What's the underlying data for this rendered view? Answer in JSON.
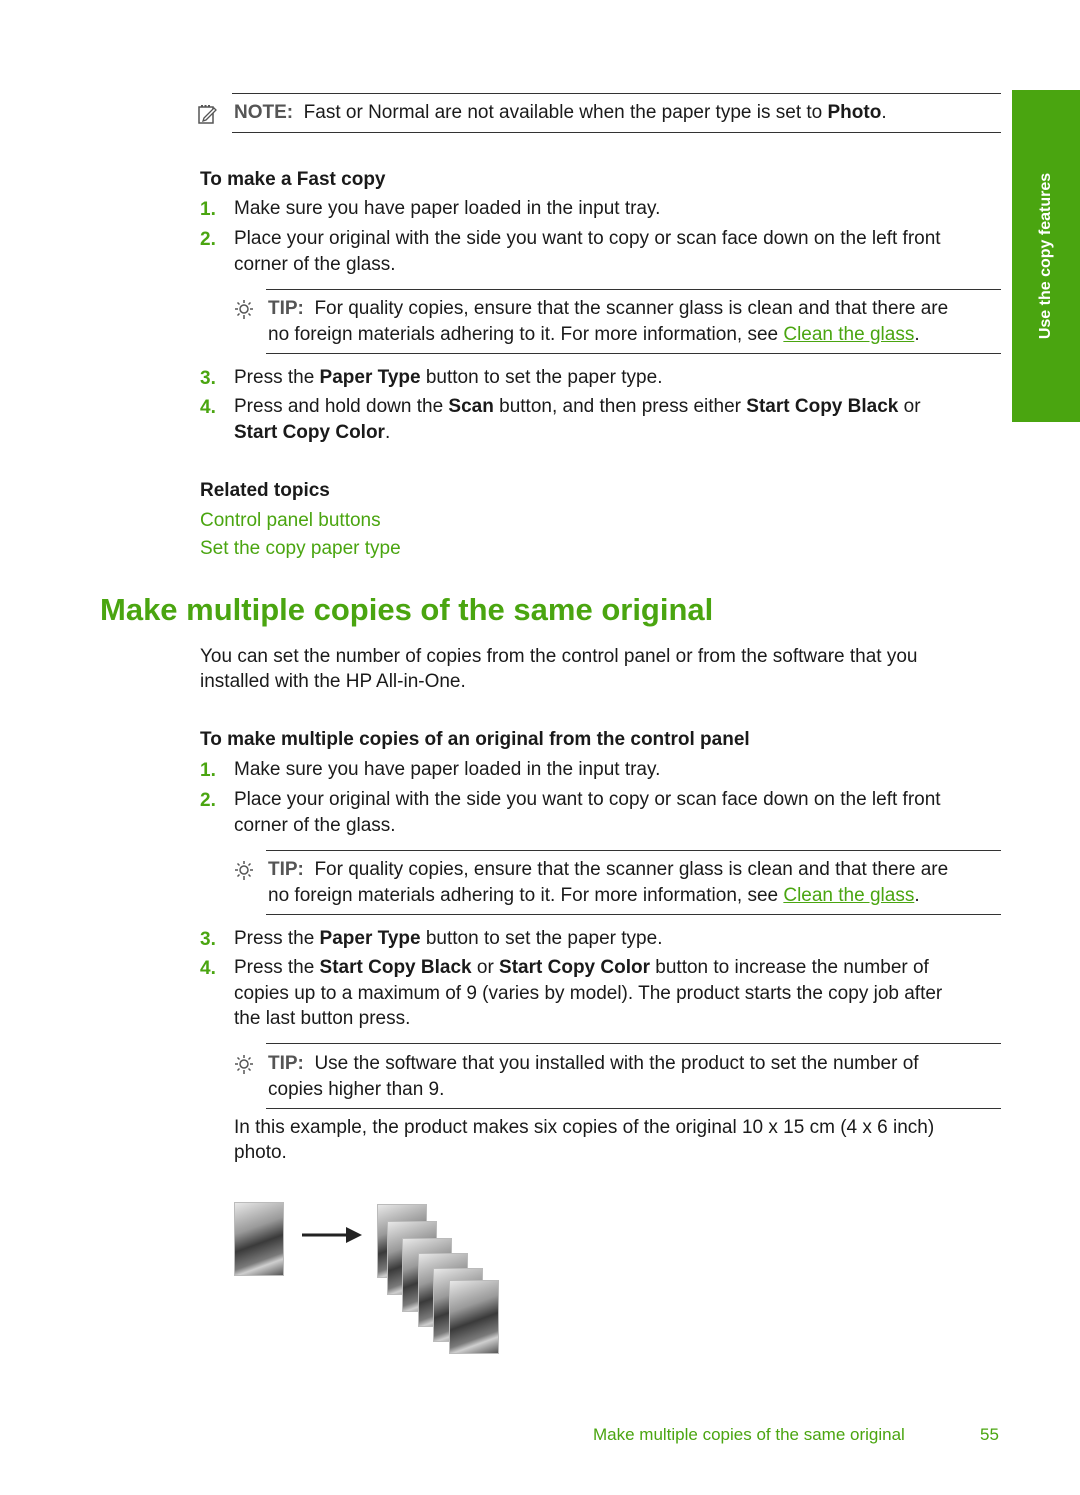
{
  "side_tab": {
    "label": "Use the copy features"
  },
  "note": {
    "icon": "note-pencil-icon",
    "label": "NOTE:",
    "text_before": "Fast or Normal are not available when the paper type is set to ",
    "bold": "Photo",
    "text_after": "."
  },
  "fast_copy": {
    "heading": "To make a Fast copy",
    "steps": [
      {
        "num": "1.",
        "line1": "Make sure you have paper loaded in the input tray."
      },
      {
        "num": "2.",
        "line1": "Place your original with the side you want to copy or scan face down on the left front",
        "line2": "corner of the glass."
      },
      {
        "num": "3.",
        "pre": "Press the ",
        "bold": "Paper Type",
        "post": " button to set the paper type."
      },
      {
        "num": "4.",
        "pre": "Press and hold down the ",
        "bold1": "Scan",
        "mid": " button, and then press either ",
        "bold2": "Start Copy Black",
        "post": " or",
        "bold3": "Start Copy Color",
        "end": "."
      }
    ],
    "tip": {
      "icon": "lightbulb-icon",
      "label": "TIP:",
      "line1": "For quality copies, ensure that the scanner glass is clean and that there are",
      "line2_pre": "no foreign materials adhering to it. For more information, see ",
      "link": "Clean the glass",
      "line2_post": "."
    }
  },
  "related": {
    "heading": "Related topics",
    "links": [
      "Control panel buttons",
      "Set the copy paper type"
    ]
  },
  "section": {
    "title": "Make multiple copies of the same original",
    "intro1": "You can set the number of copies from the control panel or from the software that you",
    "intro2": "installed with the HP All-in-One.",
    "sub_heading": "To make multiple copies of an original from the control panel",
    "steps": [
      {
        "num": "1.",
        "line1": "Make sure you have paper loaded in the input tray."
      },
      {
        "num": "2.",
        "line1": "Place your original with the side you want to copy or scan face down on the left front",
        "line2": "corner of the glass."
      },
      {
        "num": "3.",
        "pre": "Press the ",
        "bold": "Paper Type",
        "post": " button to set the paper type."
      },
      {
        "num": "4.",
        "pre": "Press the ",
        "bold1": "Start Copy Black",
        "mid": " or ",
        "bold2": "Start Copy Color",
        "post": " button to increase the number of",
        "line2": "copies up to a maximum of 9 (varies by model). The product starts the copy job after",
        "line3": "the last button press."
      }
    ],
    "tip1": {
      "label": "TIP:",
      "line1": "For quality copies, ensure that the scanner glass is clean and that there are",
      "line2_pre": "no foreign materials adhering to it. For more information, see ",
      "link": "Clean the glass",
      "line2_post": "."
    },
    "tip2": {
      "label": "TIP:",
      "line1": "Use the software that you installed with the product to set the number of",
      "line2": "copies higher than 9."
    },
    "example1": "In this example, the product makes six copies of the original 10 x 15 cm (4 x 6 inch)",
    "example2": "photo.",
    "illustration": {
      "original_count": 1,
      "copy_count": 6
    }
  },
  "footer": {
    "title": "Make multiple copies of the same original",
    "page": "55"
  }
}
